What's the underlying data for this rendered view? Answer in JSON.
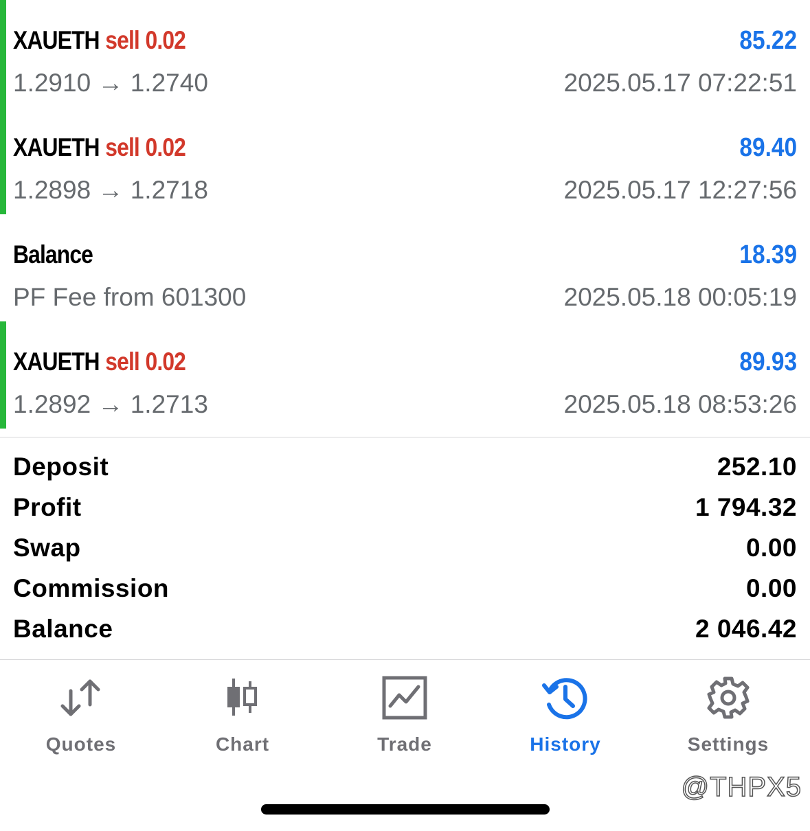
{
  "trades": [
    {
      "symbol": "XAUETH",
      "side": "sell",
      "volume": "0.02",
      "profit": "85.22",
      "prices": "1.2910 → 1.2740",
      "time": "2025.05.17 07:22:51"
    },
    {
      "symbol": "XAUETH",
      "side": "sell",
      "volume": "0.02",
      "profit": "89.40",
      "prices": "1.2898 → 1.2718",
      "time": "2025.05.17 12:27:56"
    },
    {
      "symbol": "Balance",
      "profit": "18.39",
      "prices": "PF Fee from 601300",
      "time": "2025.05.18 00:05:19"
    },
    {
      "symbol": "XAUETH",
      "side": "sell",
      "volume": "0.02",
      "profit": "89.93",
      "prices": "1.2892 → 1.2713",
      "time": "2025.05.18 08:53:26"
    }
  ],
  "summary": {
    "deposit_label": "Deposit",
    "deposit": "252.10",
    "profit_label": "Profit",
    "profit": "1 794.32",
    "swap_label": "Swap",
    "swap": "0.00",
    "commission_label": "Commission",
    "commission": "0.00",
    "balance_label": "Balance",
    "balance": "2 046.42"
  },
  "tabs": {
    "quotes": "Quotes",
    "chart": "Chart",
    "trade": "Trade",
    "history": "History",
    "settings": "Settings",
    "active": "history"
  },
  "watermark": "@THPX5",
  "colors": {
    "profit": "#1a73e8",
    "sell": "#d2392b",
    "closed_bar": "#27b73a",
    "active_tab": "#1a73e8"
  }
}
